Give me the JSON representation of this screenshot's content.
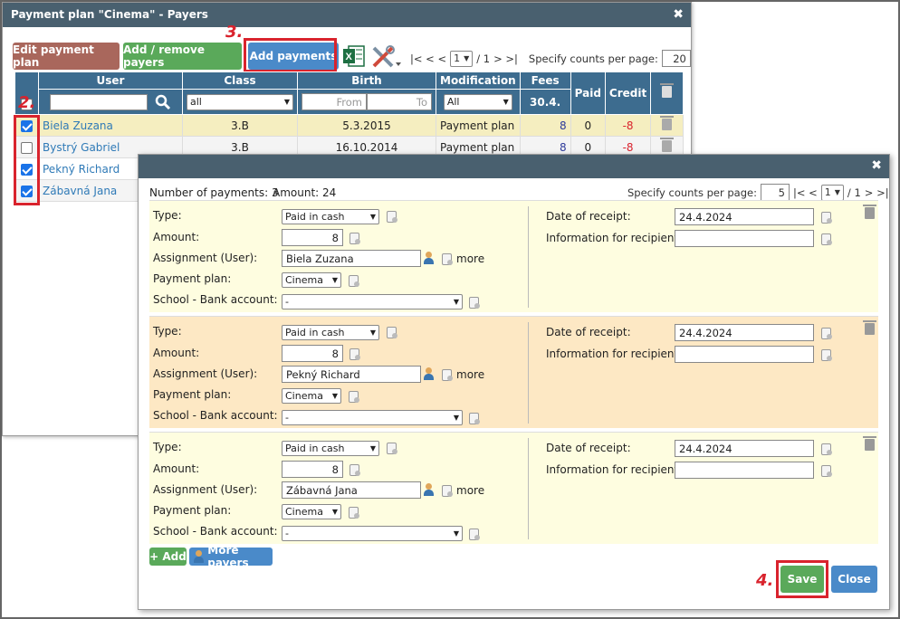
{
  "back": {
    "title": "Payment plan \"Cinema\" - Payers",
    "close": "✖",
    "btn_edit": "Edit payment plan",
    "btn_add_remove": "Add / remove payers",
    "btn_add_payments": "Add payments",
    "step2": "2.",
    "step3": "3.",
    "pager_nav_left": "|< < <",
    "page": "1",
    "pager_of": "/ 1",
    "pager_nav_right": "> >|",
    "counts_label": "Specify counts per page:",
    "counts_value": "20",
    "headers": {
      "user": "User",
      "class": "Class",
      "birth": "Birth",
      "modification": "Modification",
      "fees": "Fees",
      "fees_date": "30.4.",
      "paid": "Paid",
      "credit": "Credit"
    },
    "filters": {
      "class": "all",
      "birth_from": "From",
      "birth_to": "To",
      "modification": "All"
    },
    "rows": [
      {
        "name": "Biela Zuzana",
        "class": "3.B",
        "birth": "5.3.2015",
        "mod": "Payment plan",
        "fees": "8",
        "paid": "0",
        "credit": "-8"
      },
      {
        "name": "Bystrý Gabriel",
        "class": "3.B",
        "birth": "16.10.2014",
        "mod": "Payment plan",
        "fees": "8",
        "paid": "0",
        "credit": "-8"
      },
      {
        "name": "Pekný Richard"
      },
      {
        "name": "Zábavná Jana"
      }
    ]
  },
  "front": {
    "close": "✖",
    "summary_count": "Number of payments: 3",
    "summary_amount": "Amount: 24",
    "counts_label": "Specify counts per page:",
    "counts_value": "5",
    "pager_nav_left": "|< <",
    "page": "1",
    "pager_of": "/ 1",
    "pager_nav_right": "> >|",
    "labels": {
      "type": "Type:",
      "amount": "Amount:",
      "assignment": "Assignment (User):",
      "plan": "Payment plan:",
      "bank": "School - Bank account:",
      "date": "Date of receipt:",
      "info": "Information for recipient:",
      "more": "more"
    },
    "payments": [
      {
        "type": "Paid in cash",
        "amount": "8",
        "user": "Biela Zuzana",
        "plan": "Cinema",
        "bank": "-",
        "date": "24.4.2024",
        "info": ""
      },
      {
        "type": "Paid in cash",
        "amount": "8",
        "user": "Pekný Richard",
        "plan": "Cinema",
        "bank": "-",
        "date": "24.4.2024",
        "info": ""
      },
      {
        "type": "Paid in cash",
        "amount": "8",
        "user": "Zábavná Jana",
        "plan": "Cinema",
        "bank": "-",
        "date": "24.4.2024",
        "info": ""
      }
    ],
    "btn_add": "+ Add",
    "btn_more_payers": "More payers",
    "btn_save": "Save",
    "btn_close": "Close",
    "step4": "4."
  }
}
